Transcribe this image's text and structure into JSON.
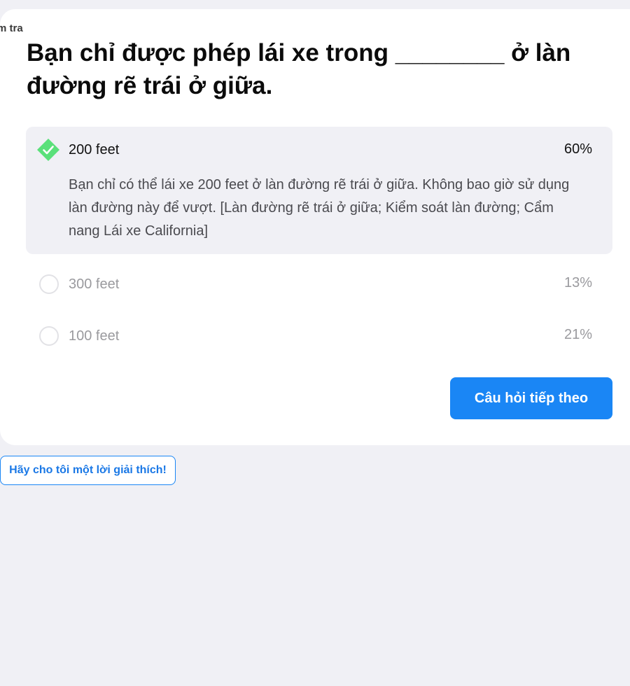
{
  "header": {
    "breadcrumb_fragment": "m tra"
  },
  "question": {
    "text": "Bạn chỉ được phép lái xe trong ________ ở làn đường rẽ trái ở giữa."
  },
  "options": [
    {
      "label": "200 feet",
      "percent": "60%",
      "selected": true,
      "correct": true,
      "explanation": "Bạn chỉ có thể lái xe 200 feet ở làn đường rẽ trái ở giữa. Không bao giờ sử dụng làn đường này để vượt. [Làn đường rẽ trái ở giữa; Kiểm soát làn đường; Cẩm nang Lái xe California]"
    },
    {
      "label": "300 feet",
      "percent": "13%",
      "selected": false
    },
    {
      "label": "100 feet",
      "percent": "21%",
      "selected": false
    }
  ],
  "actions": {
    "next_label": "Câu hỏi tiếp theo",
    "explain_label": "Hãy cho tôi một lời giải thích!"
  },
  "colors": {
    "page_bg": "#f0f0f5",
    "accent": "#1a86f5",
    "correct": "#5ae07a",
    "muted_text": "#9a9a9e"
  },
  "icons": {
    "correct_marker": "check-diamond-icon",
    "unselected_marker": "radio-circle-icon"
  }
}
